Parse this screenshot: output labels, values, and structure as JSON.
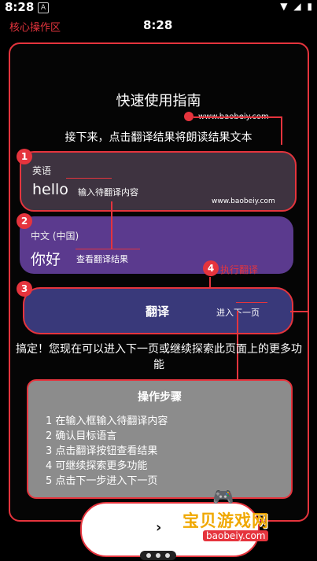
{
  "status_bar": {
    "time": "8:28",
    "notification_icon": "A"
  },
  "header": {
    "title": "核心操作区",
    "time": "8:28"
  },
  "guide": {
    "title": "快速使用指南",
    "watermark": "www.baobeiy.com",
    "subtitle": "接下来，点击翻译结果将朗读结果文本"
  },
  "source_card": {
    "badge": "1",
    "language": "英语",
    "text": "hello",
    "hint": "输入待翻译内容",
    "watermark": "www.baobeiy.com"
  },
  "target_card": {
    "badge": "2",
    "language": "中文 (中国)",
    "text": "你好",
    "hint": "查看翻译结果"
  },
  "translate_button": {
    "badge": "3",
    "label": "翻译",
    "hint": "进入下一页"
  },
  "step4": {
    "badge": "4",
    "label": "执行翻译"
  },
  "done_text": "搞定！您现在可以进入下一页或继续探索此页面上的更多功能",
  "steps_box": {
    "title": "操作步骤",
    "items": [
      "1 在输入框输入待翻译内容",
      "2 确认目标语言",
      "3 点击翻译按钮查看结果",
      "4 可继续探索更多功能",
      "5 点击下一步进入下一页"
    ]
  },
  "next_button": {
    "icon": "chevron-right-icon",
    "glyph": "›"
  },
  "logo": {
    "text": "宝贝游戏网",
    "url": "baobeiy.com"
  },
  "colors": {
    "accent": "#e5343d",
    "source_bg": "#3e3340",
    "target_bg": "#5b3a8e",
    "button_bg": "#39397a",
    "steps_bg": "#8c8c8c"
  }
}
